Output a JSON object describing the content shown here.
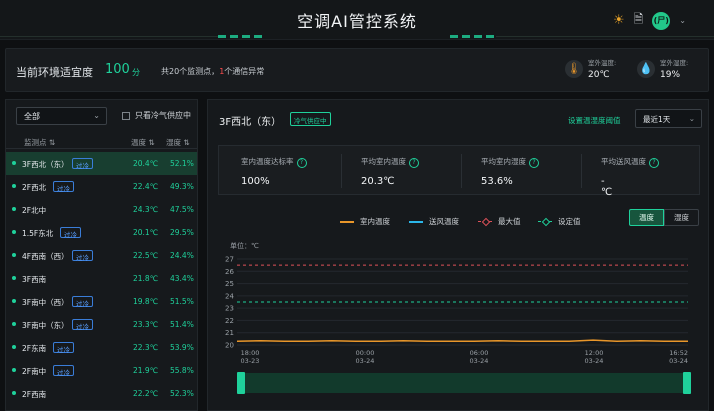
{
  "header": {
    "title": "空调AI管控系统",
    "avatar_text": "(尸)"
  },
  "comfort": {
    "label": "当前环境适宜度",
    "value": "100",
    "unit": "分",
    "monitor_prefix": "共20个监测点，",
    "monitor_abnormal": "1",
    "monitor_suffix": "个通信异常",
    "outdoor_temp_label": "室外温度:",
    "outdoor_temp_value": "20℃",
    "outdoor_humid_label": "室外湿度:",
    "outdoor_humid_value": "19%"
  },
  "left": {
    "select_value": "全部",
    "checkbox_label": "只看冷气供应中",
    "columns": {
      "name": "监测点",
      "temp": "温度",
      "humid": "湿度"
    },
    "rows": [
      {
        "name": "3F西北（东）",
        "tag": "过冷",
        "temp": "20.4℃",
        "humid": "52.1%"
      },
      {
        "name": "2F西北",
        "tag": "过冷",
        "temp": "22.4℃",
        "humid": "49.3%"
      },
      {
        "name": "2F北中",
        "tag": "",
        "temp": "24.3℃",
        "humid": "47.5%"
      },
      {
        "name": "1.5F东北",
        "tag": "过冷",
        "temp": "20.1℃",
        "humid": "29.5%"
      },
      {
        "name": "4F西南（西）",
        "tag": "过冷",
        "temp": "22.5℃",
        "humid": "24.4%"
      },
      {
        "name": "3F西南",
        "tag": "",
        "temp": "21.8℃",
        "humid": "43.4%"
      },
      {
        "name": "3F南中（西）",
        "tag": "过冷",
        "temp": "19.8℃",
        "humid": "51.5%"
      },
      {
        "name": "3F南中（东）",
        "tag": "过冷",
        "temp": "23.3℃",
        "humid": "51.4%"
      },
      {
        "name": "2F东南",
        "tag": "过冷",
        "temp": "22.3℃",
        "humid": "53.9%"
      },
      {
        "name": "2F南中",
        "tag": "过冷",
        "temp": "21.9℃",
        "humid": "55.8%"
      },
      {
        "name": "2F西南",
        "tag": "",
        "temp": "22.2℃",
        "humid": "52.3%"
      }
    ]
  },
  "detail": {
    "title": "3F西北（东）",
    "badge": "冷气供应中",
    "threshold_link": "设置温湿度阈值",
    "range_value": "最近1天",
    "stats": [
      {
        "label": "室内温度达标率",
        "value": "100%"
      },
      {
        "label": "平均室内温度",
        "value": "20.3℃"
      },
      {
        "label": "平均室内湿度",
        "value": "53.6%"
      },
      {
        "label": "平均送风温度",
        "value": "-℃"
      }
    ],
    "legend": [
      "室内温度",
      "送风温度",
      "最大值",
      "设定值"
    ],
    "toggle": [
      "温度",
      "湿度"
    ],
    "colors": {
      "indoor": "#e8962a",
      "supply": "#2bb6e8",
      "max": "#e0525a",
      "setpoint": "#1fd19b"
    }
  },
  "chart_data": {
    "type": "line",
    "ylabel": "单位：℃",
    "yticks": [
      20,
      21,
      22,
      23,
      24,
      25,
      26,
      27
    ],
    "ylim": [
      20,
      27
    ],
    "xticks": [
      {
        "t": "18:00",
        "d": "03-23"
      },
      {
        "t": "00:00",
        "d": "03-24"
      },
      {
        "t": "06:00",
        "d": "03-24"
      },
      {
        "t": "12:00",
        "d": "03-24"
      },
      {
        "t": "16:52",
        "d": "03-24"
      }
    ],
    "series": [
      {
        "name": "室内温度",
        "values": [
          20.3,
          20.35,
          20.3,
          20.3,
          20.35,
          20.3,
          20.3,
          20.35,
          20.3,
          20.3,
          20.3,
          20.35,
          20.3,
          20.3,
          20.3,
          20.4,
          20.3,
          20.35,
          20.3,
          20.3
        ]
      },
      {
        "name": "最大值",
        "values": [
          26.5
        ]
      },
      {
        "name": "设定值",
        "values": [
          23.5
        ]
      }
    ]
  }
}
